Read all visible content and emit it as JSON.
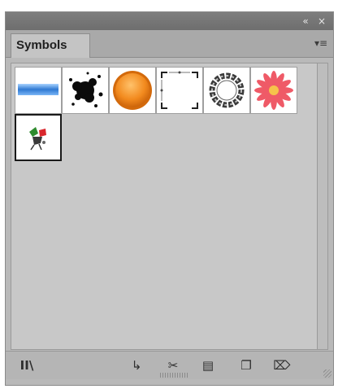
{
  "panel": {
    "tab_label": "Symbols",
    "collapse_glyph": "«",
    "close_glyph": "×",
    "menu_glyph": "▾≡"
  },
  "symbols": [
    {
      "name": "blue-gradient-bar-symbol"
    },
    {
      "name": "ink-splatter-symbol"
    },
    {
      "name": "orange-button-symbol"
    },
    {
      "name": "frame-corners-symbol"
    },
    {
      "name": "ribbon-wreath-symbol"
    },
    {
      "name": "pink-flower-symbol"
    },
    {
      "name": "flag-ornament-symbol",
      "selected": true
    }
  ],
  "footer": {
    "library_glyph": "II\\",
    "place_glyph": "↳",
    "break_link_glyph": "✂",
    "options_glyph": "▤",
    "new_glyph": "❐",
    "delete_glyph": "⌦"
  },
  "colors": {
    "panel_bg": "#b9b9b9",
    "title_bar": "#727272",
    "tab_bg": "#c4c4c4",
    "content_bg": "#c8c8c8"
  }
}
